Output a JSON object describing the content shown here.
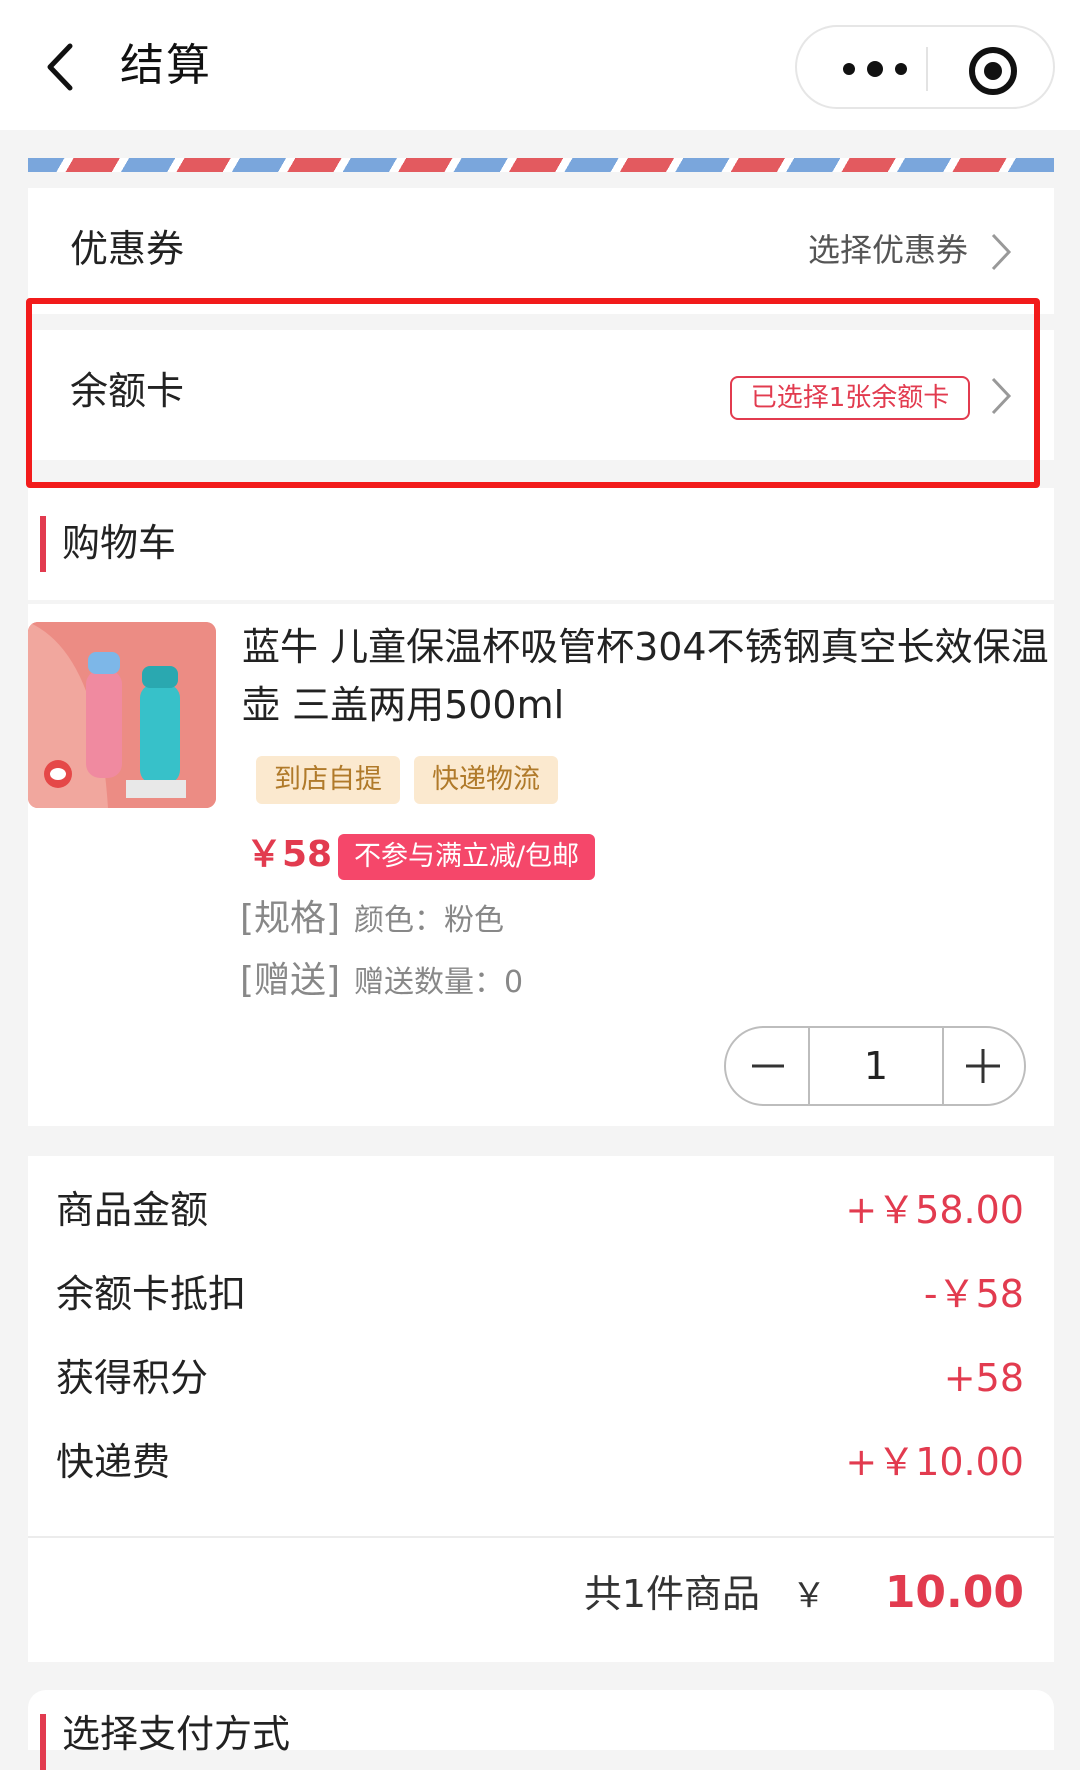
{
  "nav": {
    "title": "结算"
  },
  "coupon": {
    "label": "优惠券",
    "value": "选择优惠券"
  },
  "balance_card": {
    "label": "余额卡",
    "value": "已选择1张余额卡"
  },
  "cart": {
    "section_title": "购物车",
    "product": {
      "title": "蓝牛 儿童保温杯吸管杯304不锈钢真空长效保温壶 三盖两用500ml",
      "tags": [
        "到店自提",
        "快递物流"
      ],
      "price": "￥58",
      "promo": "不参与满立减/包邮",
      "spec_key": "[规格]",
      "spec_value": "颜色：粉色",
      "gift_key": "[赠送]",
      "gift_value": "赠送数量：0",
      "quantity": "1"
    }
  },
  "summary": {
    "rows": [
      {
        "label": "商品金额",
        "value": "+￥58.00"
      },
      {
        "label": "余额卡抵扣",
        "value": "-￥58"
      },
      {
        "label": "获得积分",
        "value": "+58"
      },
      {
        "label": "快递费",
        "value": "+￥10.00"
      }
    ],
    "total_text": "共1件商品",
    "total_currency": "￥",
    "total_amount": "10.00"
  },
  "payment": {
    "section_title": "选择支付方式"
  },
  "colors": {
    "accent": "#e23b4f",
    "highlight": "#f21b1b",
    "tag_bg": "#fbe9cf"
  }
}
